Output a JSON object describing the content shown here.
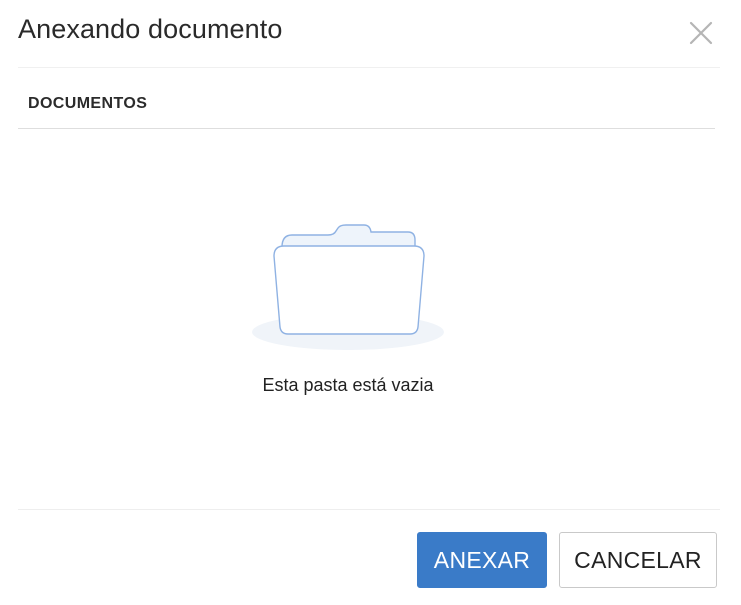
{
  "dialog": {
    "title": "Anexando documento",
    "close_icon": "close-icon"
  },
  "section": {
    "label": "DOCUMENTOS"
  },
  "empty_state": {
    "icon": "folder-icon",
    "message": "Esta pasta está vazia"
  },
  "actions": {
    "attach_label": "ANEXAR",
    "cancel_label": "CANCELAR"
  },
  "colors": {
    "primary": "#3a7bc8",
    "folder_stroke": "#8fb2e3",
    "folder_fill": "#ffffff",
    "folder_tab_fill": "#eef4fb",
    "shadow": "#f0f4f9"
  }
}
